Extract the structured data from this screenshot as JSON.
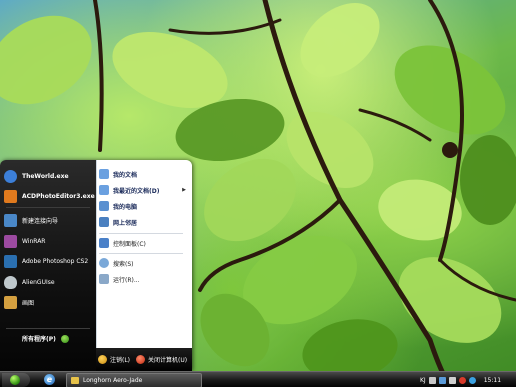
{
  "start_menu": {
    "pinned": [
      {
        "label": "TheWorld.exe",
        "icon": "theworld-browser-icon",
        "color": "#3c7fd8"
      },
      {
        "label": "ACDPhotoEditor3.exe",
        "icon": "acdsee-photo-editor-icon",
        "color": "#e07a1e"
      }
    ],
    "recent": [
      {
        "label": "新建连接向导",
        "icon": "network-wizard-icon",
        "color": "#4a88c8"
      },
      {
        "label": "WinRAR",
        "icon": "winrar-icon",
        "color": "#9c4aa0"
      },
      {
        "label": "Adobe Photoshop CS2",
        "icon": "photoshop-icon",
        "color": "#2a6fb0"
      },
      {
        "label": "AlienGUIse",
        "icon": "alien-icon",
        "color": "#bfc8cc"
      },
      {
        "label": "画图",
        "icon": "paint-icon",
        "color": "#d4a040"
      }
    ],
    "all_programs_label": "所有程序(P)",
    "places": [
      {
        "label": "我的文档",
        "icon": "my-documents-icon",
        "color": "#6aa0e0"
      },
      {
        "label": "我最近的文档(D)",
        "icon": "recent-documents-icon",
        "color": "#6aa0e0",
        "submenu": true
      },
      {
        "label": "我的电脑",
        "icon": "my-computer-icon",
        "color": "#5a90d0"
      },
      {
        "label": "网上邻居",
        "icon": "network-places-icon",
        "color": "#4a80c0"
      }
    ],
    "system": [
      {
        "label": "控制面板(C)",
        "icon": "control-panel-icon",
        "color": "#4a80c8"
      }
    ],
    "tools": [
      {
        "label": "搜索(S)",
        "icon": "search-icon",
        "color": "#7aa8d8"
      },
      {
        "label": "运行(R)...",
        "icon": "run-icon",
        "color": "#8aa8c8"
      }
    ],
    "footer": {
      "logoff_label": "注销(L)",
      "shutdown_label": "关闭计算机(U)"
    }
  },
  "taskbar": {
    "window_button": "Longhorn Aero-Jade",
    "ie_glyph": "e",
    "tray_language": "KJ",
    "clock": "15:11"
  },
  "colors": {
    "taskbar": "#1a1a1a",
    "start_orb": "#2d8c10",
    "menu_dark": "#101010"
  }
}
